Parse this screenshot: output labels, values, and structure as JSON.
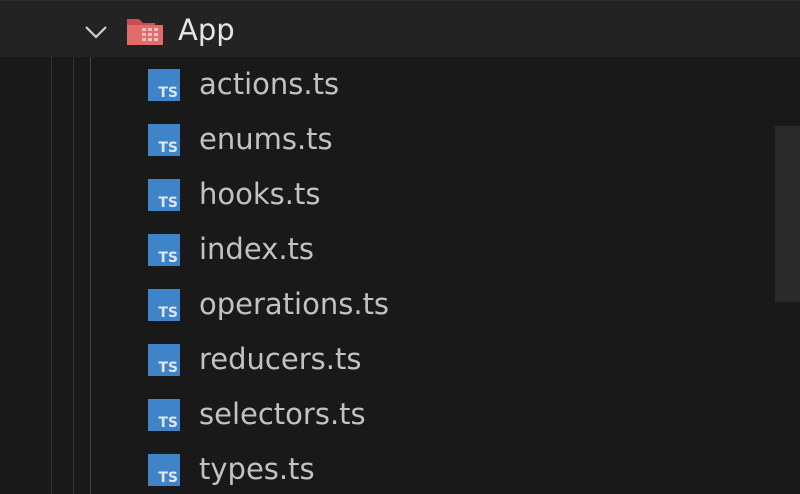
{
  "explorer": {
    "folder": {
      "name": "App",
      "expanded": true,
      "icon": "folder-open-icon",
      "icon_color": "#e06c6c"
    },
    "files": [
      {
        "name": "actions.ts",
        "icon_label": "TS"
      },
      {
        "name": "enums.ts",
        "icon_label": "TS"
      },
      {
        "name": "hooks.ts",
        "icon_label": "TS"
      },
      {
        "name": "index.ts",
        "icon_label": "TS"
      },
      {
        "name": "operations.ts",
        "icon_label": "TS"
      },
      {
        "name": "reducers.ts",
        "icon_label": "TS"
      },
      {
        "name": "selectors.ts",
        "icon_label": "TS"
      },
      {
        "name": "types.ts",
        "icon_label": "TS"
      }
    ],
    "ts_icon_color": "#3f84c9",
    "background_color": "#191919"
  }
}
